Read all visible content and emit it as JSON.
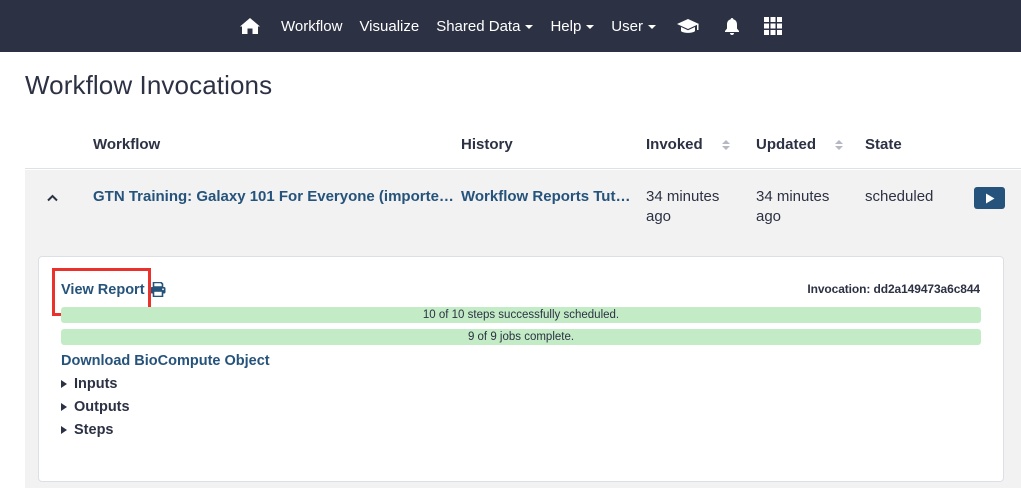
{
  "nav": {
    "items": [
      {
        "label": "Workflow",
        "has_caret": false
      },
      {
        "label": "Visualize",
        "has_caret": false
      },
      {
        "label": "Shared Data",
        "has_caret": true
      },
      {
        "label": "Help",
        "has_caret": true
      },
      {
        "label": "User",
        "has_caret": true
      }
    ],
    "icons": [
      "home-icon",
      "graduation-cap-icon",
      "bell-icon",
      "apps-grid-icon"
    ]
  },
  "page": {
    "title": "Workflow Invocations"
  },
  "table": {
    "headers": {
      "workflow": "Workflow",
      "history": "History",
      "invoked": "Invoked",
      "updated": "Updated",
      "state": "State"
    },
    "rows": [
      {
        "workflow": "GTN Training: Galaxy 101 For Everyone (importe…",
        "history": "Workflow Reports Tut…",
        "invoked_line1": "34 minutes",
        "invoked_line2": "ago",
        "updated_line1": "34 minutes",
        "updated_line2": "ago",
        "state": "scheduled"
      }
    ]
  },
  "detail": {
    "view_report": "View Report",
    "invocation_id": "Invocation: dd2a149473a6c844",
    "steps_progress": {
      "text": "10 of 10 steps successfully scheduled.",
      "fraction": 1.0
    },
    "jobs_progress": {
      "text": "9 of 9 jobs complete.",
      "fraction": 1.0
    },
    "download": "Download BioCompute Object",
    "sections": [
      "Inputs",
      "Outputs",
      "Steps"
    ]
  },
  "colors": {
    "navbar": "#2c3143",
    "link": "#25537b",
    "progress_success": "#c3ecc6",
    "highlight": "#e8322b"
  }
}
